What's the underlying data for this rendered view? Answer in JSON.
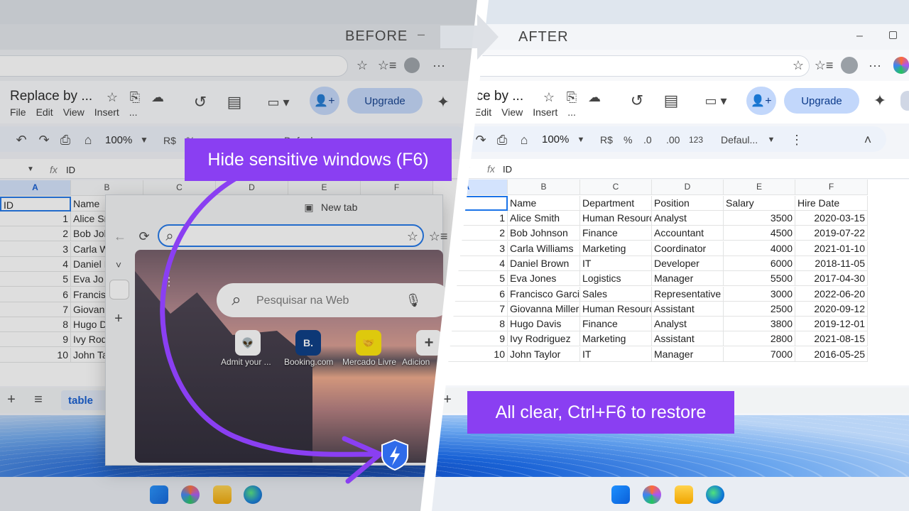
{
  "labels": {
    "before": "BEFORE",
    "after": "AFTER",
    "hide_callout": "Hide sensitive windows (F6)",
    "restore_callout": "All clear, Ctrl+F6 to restore"
  },
  "doc": {
    "title": "Replace by ...",
    "title_after": "ace by ...",
    "menu": [
      "File",
      "Edit",
      "View",
      "Insert",
      "..."
    ],
    "upgrade": "Upgrade"
  },
  "toolbar": {
    "zoom": "100%",
    "currency": "R$",
    "percent": "%",
    "dec_dec": ".0",
    "inc_dec": ".00",
    "format": "123",
    "font": "Defaul...",
    "font_before": "Defaul"
  },
  "formula": {
    "cell_value": "ID",
    "fx": "fx"
  },
  "columns": [
    "A",
    "B",
    "C",
    "D",
    "E",
    "F"
  ],
  "headers": [
    "ID",
    "Name",
    "Department",
    "Position",
    "Salary",
    "Hire Date"
  ],
  "rows": [
    [
      "1",
      "Alice Smith",
      "Human Resources",
      "Analyst",
      "3500",
      "2020-03-15"
    ],
    [
      "2",
      "Bob Johnson",
      "Finance",
      "Accountant",
      "4500",
      "2019-07-22"
    ],
    [
      "3",
      "Carla Williams",
      "Marketing",
      "Coordinator",
      "4000",
      "2021-01-10"
    ],
    [
      "4",
      "Daniel Brown",
      "IT",
      "Developer",
      "6000",
      "2018-11-05"
    ],
    [
      "5",
      "Eva Jones",
      "Logistics",
      "Manager",
      "5500",
      "2017-04-30"
    ],
    [
      "6",
      "Francisco Garcia",
      "Sales",
      "Representative",
      "3000",
      "2022-06-20"
    ],
    [
      "7",
      "Giovanna Miller",
      "Human Resources",
      "Assistant",
      "2500",
      "2020-09-12"
    ],
    [
      "8",
      "Hugo Davis",
      "Finance",
      "Analyst",
      "3800",
      "2019-12-01"
    ],
    [
      "9",
      "Ivy Rodriguez",
      "Marketing",
      "Assistant",
      "2800",
      "2021-08-15"
    ],
    [
      "10",
      "John Taylor",
      "IT",
      "Manager",
      "7000",
      "2016-05-25"
    ]
  ],
  "before_names": [
    "Alice Sr",
    "Bob Jol",
    "Carla W",
    "Daniel I",
    "Eva Jo",
    "Francis",
    "Giovan",
    "Hugo D",
    "Ivy Rod",
    "John Ta"
  ],
  "sheet_tab": "table",
  "newtab": {
    "title": "New tab",
    "search_placeholder": "Pesquisar na Web",
    "quick_links": [
      {
        "label": "Admit your ...",
        "glyph": "👽",
        "color": "#ff4500"
      },
      {
        "label": "Booking.com",
        "glyph": "B.",
        "color": "#003580"
      },
      {
        "label": "Mercado Livre",
        "glyph": "🤝",
        "color": "#ffe600"
      },
      {
        "label": "Adicion",
        "glyph": "+",
        "color": "#ffffff"
      }
    ]
  },
  "icons": {
    "star": "☆",
    "folder": "⎘",
    "cloud": "☁",
    "history": "↺",
    "comment": "▤",
    "video": "▭",
    "gemini": "✦",
    "undo": "↶",
    "redo": "↷",
    "print": "⎙",
    "paint": "⌂",
    "more": "⋮",
    "chevron_up": "˄",
    "chevron_down": "˅",
    "plus": "+",
    "list": "≡",
    "back": "←",
    "reload": "⟳",
    "search": "⌕",
    "mic": "🎙",
    "shield": "⚡"
  }
}
